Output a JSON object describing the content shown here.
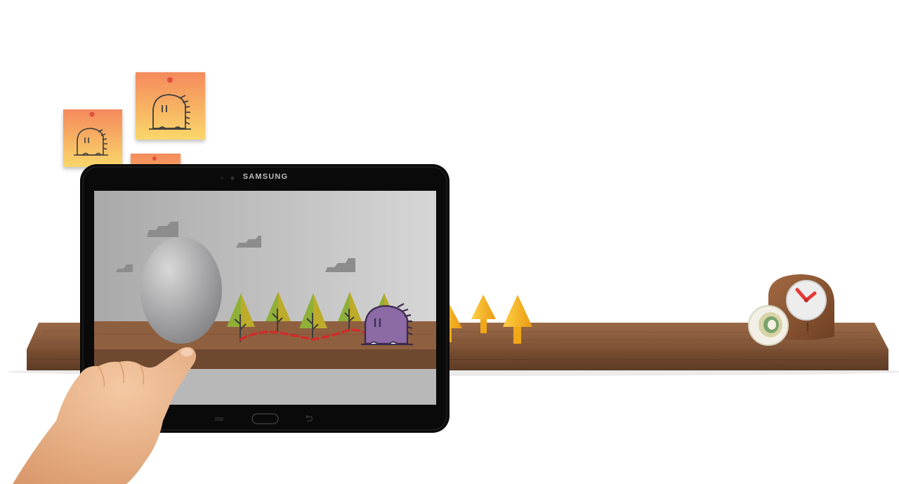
{
  "device": {
    "brand": "SAMSUNG"
  },
  "scene": {
    "icons": [
      "sticky-note-monster-icon",
      "monster-character-icon",
      "tree-icon",
      "cloud-icon",
      "clock-icon",
      "tape-roll-icon",
      "hand-icon"
    ]
  },
  "colors": {
    "shelf": "#8a5a3b",
    "sticky_note_top": "#f58a5c",
    "sticky_note_bottom": "#f9d76a",
    "monster": "#8b6aa5",
    "tree_green": "#8fb038",
    "tree_orange": "#f5b21a",
    "path_dash": "#d22a2a",
    "clock_red": "#e53935"
  }
}
